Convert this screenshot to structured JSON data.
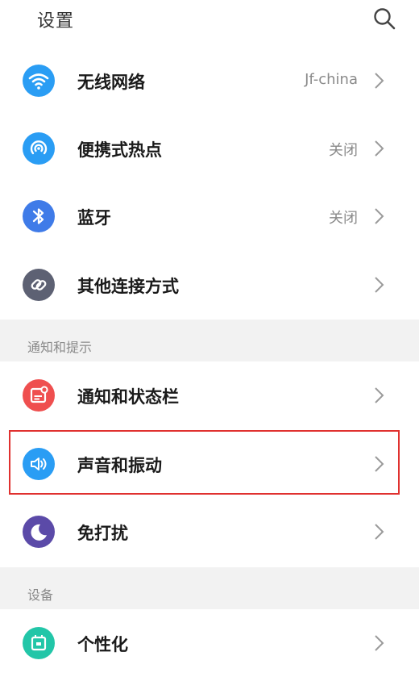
{
  "header": {
    "title": "设置",
    "search_icon": "search-icon"
  },
  "connections": [
    {
      "label": "无线网络",
      "value": "Jf-china",
      "icon": "wifi-icon",
      "color": "#2a9df4"
    },
    {
      "label": "便携式热点",
      "value": "关闭",
      "icon": "hotspot-icon",
      "color": "#2a9df4"
    },
    {
      "label": "蓝牙",
      "value": "关闭",
      "icon": "bluetooth-icon",
      "color": "#3f7be8"
    },
    {
      "label": "其他连接方式",
      "value": "",
      "icon": "link-icon",
      "color": "#5d6173"
    }
  ],
  "sections": {
    "notifications": {
      "title": "通知和提示",
      "items": [
        {
          "label": "通知和状态栏",
          "icon": "notification-icon",
          "color": "#ef4f4f"
        },
        {
          "label": "声音和振动",
          "icon": "speaker-icon",
          "color": "#2a9df4"
        },
        {
          "label": "免打扰",
          "icon": "moon-icon",
          "color": "#5b4aa8"
        }
      ]
    },
    "device": {
      "title": "设备",
      "items": [
        {
          "label": "个性化",
          "icon": "theme-icon",
          "color": "#22c6a8"
        }
      ]
    }
  },
  "highlight_color": "#e0312f"
}
